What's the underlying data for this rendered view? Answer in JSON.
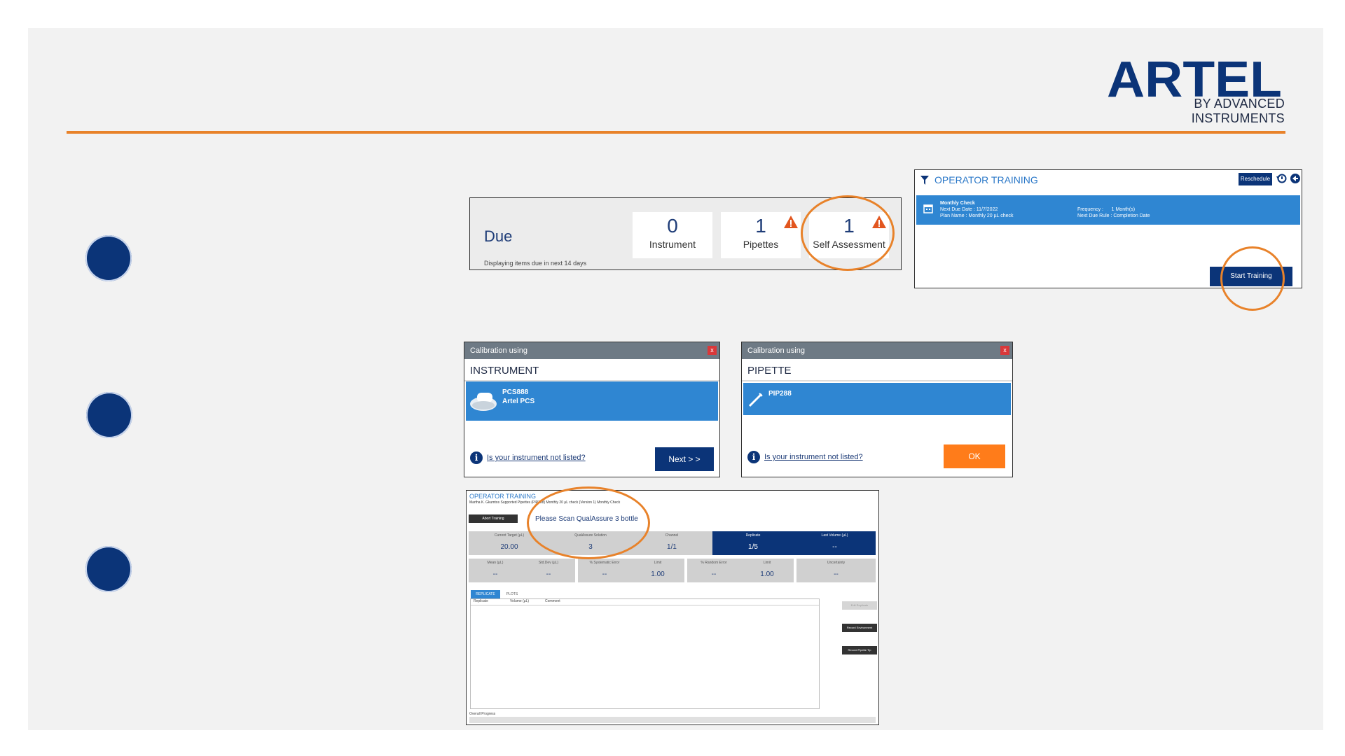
{
  "brand": {
    "logo_text": "ARTEL",
    "logo_subtitle": "BY ADVANCED INSTRUMENTS",
    "accent_color": "#e8822a",
    "navy_color": "#0b3478",
    "blue_color": "#2f86d2"
  },
  "due_widget": {
    "title": "Due",
    "note": "Displaying items due in next 14 days",
    "cards": [
      {
        "count": "0",
        "label": "Instrument"
      },
      {
        "count": "1",
        "label": "Pipettes",
        "icon": "warning-icon"
      },
      {
        "count": "1",
        "label": "Self Assessment",
        "icon": "warning-icon"
      }
    ]
  },
  "operator_training_panel": {
    "title": "OPERATOR TRAINING",
    "reschedule_label": "Reschedule",
    "item": {
      "name": "Monthly Check",
      "next_due_date": "Next Due Date : 11/7/2022",
      "plan_name": "Plan Name : Monthly 20 µL check",
      "frequency": "Frequency :      1 Month(s)",
      "due_rule": "Next Due Rule : Completion Date"
    },
    "start_label": "Start Training"
  },
  "instrument_dialog": {
    "bar_title": "Calibration using",
    "close_label": "x",
    "heading": "INSTRUMENT",
    "item_id": "PCS888",
    "item_name": "Artel PCS",
    "link_text": "Is your instrument not listed?",
    "next_label": "Next > >"
  },
  "pipette_dialog": {
    "bar_title": "Calibration using",
    "close_label": "x",
    "heading": "PIPETTE",
    "item_id": "PIP288",
    "link_text": "Is your instrument not listed?",
    "ok_label": "OK"
  },
  "training_screen": {
    "title": "OPERATOR TRAINING",
    "meta": "Martha K. Gkumtos   Supported Pipettes (PIP288)   Monthly 20 µL check (Version 1)   Monthly Check",
    "abort_label": "Abort Training",
    "scan_prompt": "Please Scan QualAssure 3 bottle",
    "row1": [
      {
        "header": "Current Target (µL)",
        "value": "20.00"
      },
      {
        "header": "QualAssure Solution",
        "value": "3"
      },
      {
        "header": "Channel",
        "value": "1/1"
      },
      {
        "header": "Replicate",
        "value": "1/5"
      },
      {
        "header": "Last Volume (µL)",
        "value": "--"
      }
    ],
    "row2": [
      {
        "header": "Mean (µL)",
        "value": "--"
      },
      {
        "header": "Std.Dev (µL)",
        "value": "--"
      },
      {
        "header": "% Systematic Error",
        "value": "--"
      },
      {
        "header": "Limit",
        "value": "1.00"
      },
      {
        "header": "% Random Error",
        "value": "--"
      },
      {
        "header": "Limit",
        "value": "1.00"
      },
      {
        "header": "Uncertainty",
        "value": "--"
      }
    ],
    "tabs": [
      "REPLICATE",
      "PLOTS"
    ],
    "table_headers": [
      "Replicate",
      "Volume (µL)",
      "Comment"
    ],
    "side_buttons": [
      "Edit Replicate",
      "Record Environment",
      "Record Pipette Tip"
    ],
    "footer": "Overall Progress"
  }
}
